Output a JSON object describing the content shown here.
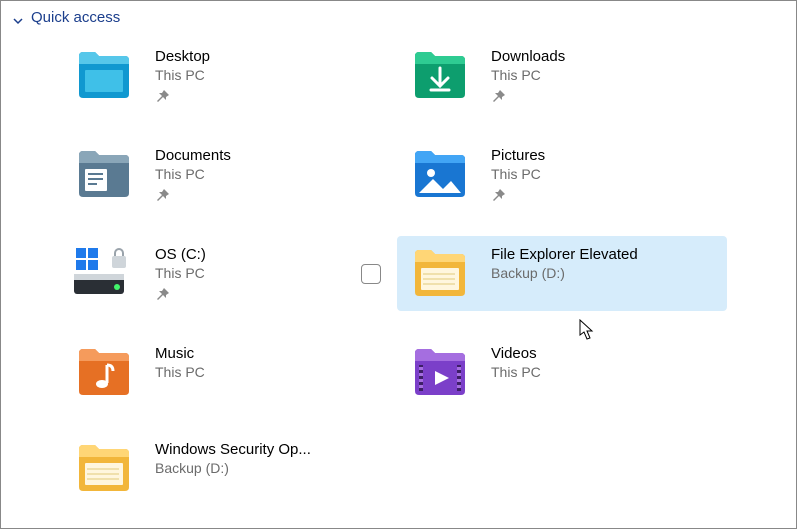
{
  "header": {
    "title": "Quick access"
  },
  "items": [
    {
      "name": "Desktop",
      "location": "This PC",
      "icon": "desktop",
      "pinned": true,
      "hover": false
    },
    {
      "name": "Downloads",
      "location": "This PC",
      "icon": "downloads",
      "pinned": true,
      "hover": false
    },
    {
      "name": "Documents",
      "location": "This PC",
      "icon": "documents",
      "pinned": true,
      "hover": false
    },
    {
      "name": "Pictures",
      "location": "This PC",
      "icon": "pictures",
      "pinned": true,
      "hover": false
    },
    {
      "name": "OS (C:)",
      "location": "This PC",
      "icon": "os-drive",
      "pinned": true,
      "hover": false
    },
    {
      "name": "File Explorer Elevated",
      "location": "Backup (D:)",
      "icon": "folder",
      "pinned": false,
      "hover": true
    },
    {
      "name": "Music",
      "location": "This PC",
      "icon": "music",
      "pinned": false,
      "hover": false
    },
    {
      "name": "Videos",
      "location": "This PC",
      "icon": "videos",
      "pinned": false,
      "hover": false
    },
    {
      "name": "Windows Security Op...",
      "location": "Backup (D:)",
      "icon": "folder",
      "pinned": false,
      "hover": false
    }
  ]
}
